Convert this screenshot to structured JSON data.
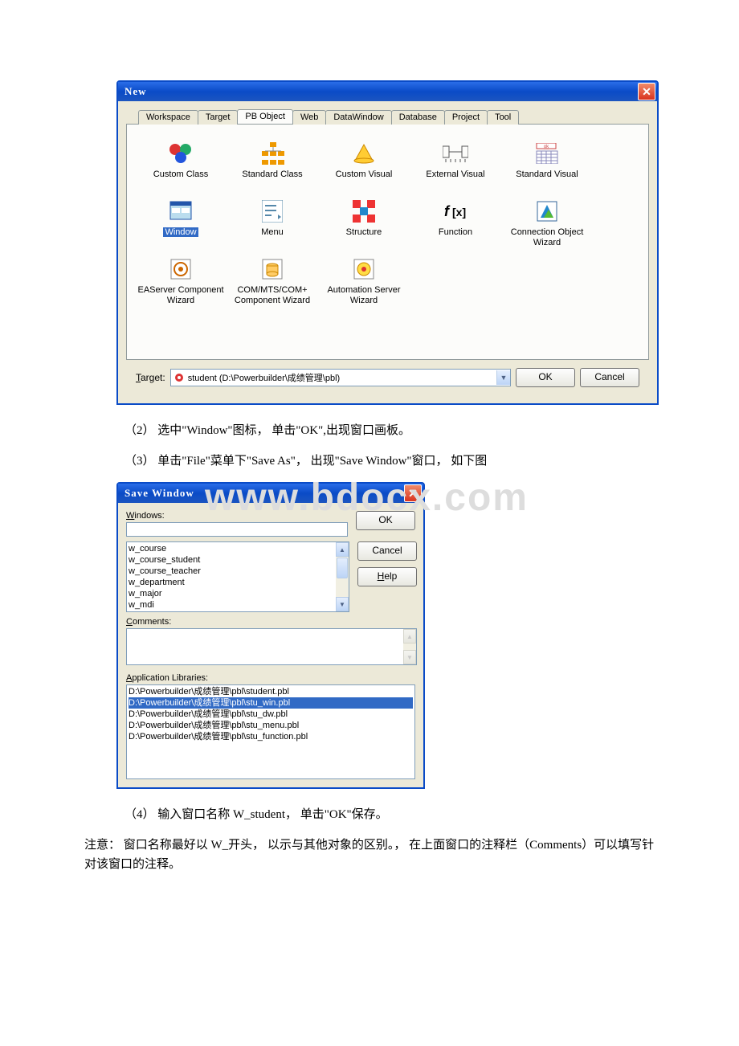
{
  "new_dialog": {
    "title": "New",
    "tabs": [
      "Workspace",
      "Target",
      "PB Object",
      "Web",
      "DataWindow",
      "Database",
      "Project",
      "Tool"
    ],
    "active_tab": "PB Object",
    "objects": {
      "r1": [
        "Custom Class",
        "Standard Class",
        "Custom Visual",
        "External Visual",
        "Standard Visual"
      ],
      "r2": [
        "Window",
        "Menu",
        "Structure",
        "Function",
        "Connection Object Wizard"
      ],
      "r3": [
        "EAServer Component Wizard",
        "COM/MTS/COM+ Component Wizard",
        "Automation Server Wizard"
      ]
    },
    "selected": "Window",
    "target_label": "Target:",
    "target_value": "student (D:\\Powerbuilder\\成绩管理\\pbl)",
    "ok": "OK",
    "cancel": "Cancel"
  },
  "text": {
    "step2": "（2） 选中\"Window\"图标， 单击\"OK\",出现窗口画板。",
    "step3": "（3） 单击\"File\"菜单下\"Save As\"， 出现\"Save Window\"窗口， 如下图",
    "step4": "（4） 输入窗口名称 W_student， 单击\"OK\"保存。",
    "note": "注意： 窗口名称最好以 W_开头， 以示与其他对象的区别。， 在上面窗口的注释栏（Comments）可以填写针对该窗口的注释。"
  },
  "save_window": {
    "title": "Save Window",
    "windows_label": "Windows:",
    "ok": "OK",
    "cancel": "Cancel",
    "help": "Help",
    "list": [
      "w_course",
      "w_course_student",
      "w_course_teacher",
      "w_department",
      "w_major",
      "w_mdi"
    ],
    "comments_label": "Comments:",
    "applib_label": "Application Libraries:",
    "applib": [
      "D:\\Powerbuilder\\成绩管理\\pbl\\student.pbl",
      "D:\\Powerbuilder\\成绩管理\\pbl\\stu_win.pbl",
      "D:\\Powerbuilder\\成绩管理\\pbl\\stu_dw.pbl",
      "D:\\Powerbuilder\\成绩管理\\pbl\\stu_menu.pbl",
      "D:\\Powerbuilder\\成绩管理\\pbl\\stu_function.pbl"
    ],
    "applib_selected": 1
  },
  "watermark": "www.bdocx.com"
}
